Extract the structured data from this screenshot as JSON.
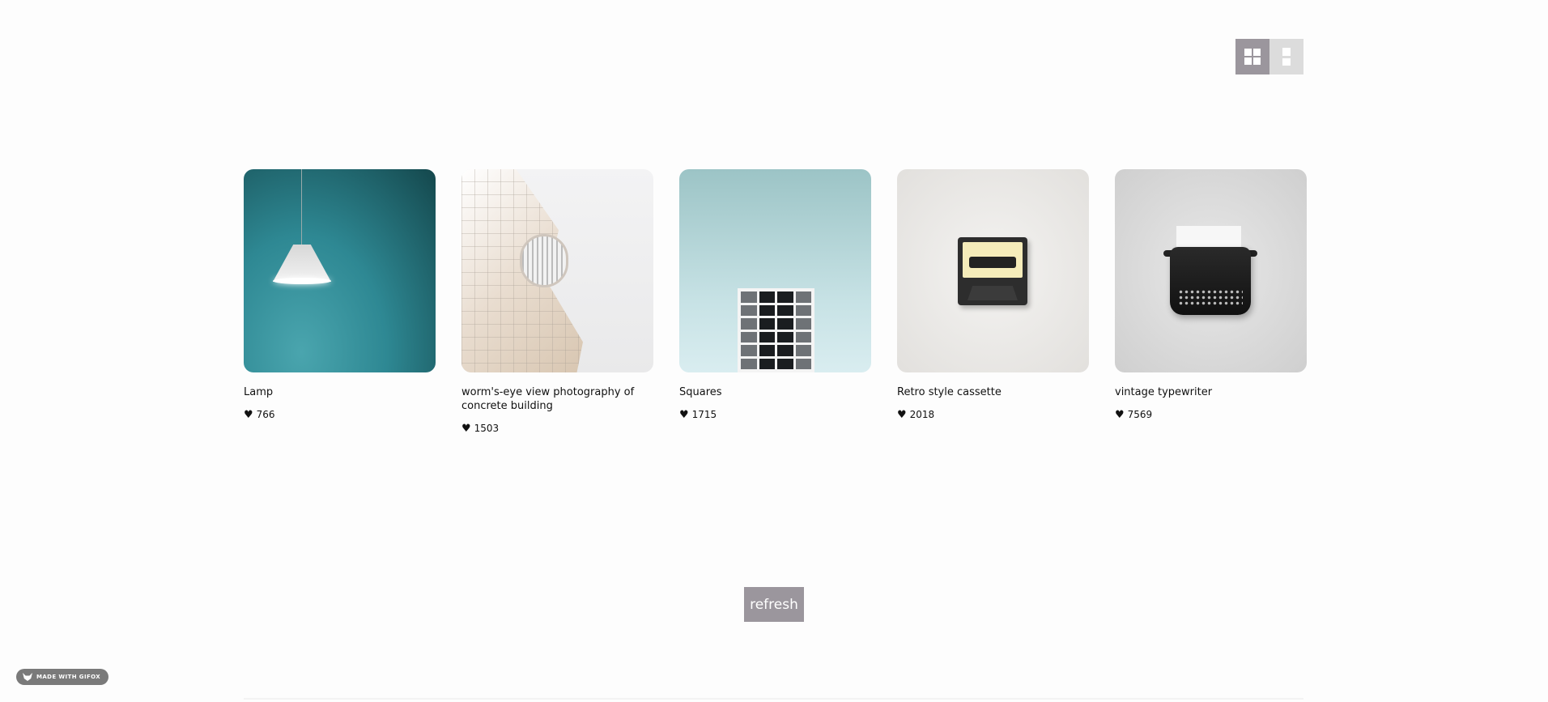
{
  "view_toggle": {
    "grid_icon": "grid-view-icon",
    "list_icon": "list-view-icon",
    "active_color": "#9b969d",
    "inactive_color": "#dcdcdc"
  },
  "cards": [
    {
      "title": "Lamp",
      "likes": "766"
    },
    {
      "title": "worm's-eye view photography of concrete building",
      "likes": "1503"
    },
    {
      "title": "Squares",
      "likes": "1715"
    },
    {
      "title": "Retro style cassette",
      "likes": "2018"
    },
    {
      "title": "vintage typewriter",
      "likes": "7569"
    }
  ],
  "like_icon": "heart-icon",
  "refresh_label": "refresh",
  "badge": {
    "label": "MADE WITH GIFOX",
    "icon": "fox-icon"
  }
}
